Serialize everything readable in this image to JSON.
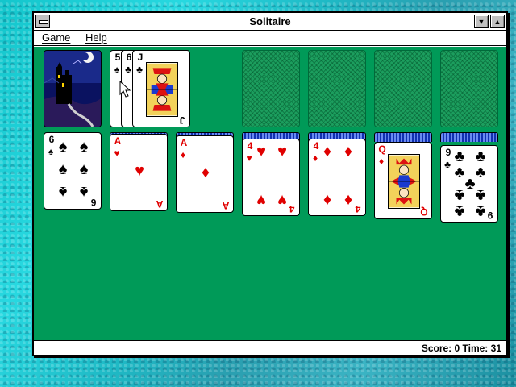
{
  "window": {
    "title": "Solitaire",
    "minimize_glyph": "▼",
    "maximize_glyph": "▲"
  },
  "menu": {
    "game": "Game",
    "help": "Help"
  },
  "status": {
    "text": "Score: 0 Time: 31"
  },
  "colors": {
    "felt": "#009a58",
    "red_suit": "#e00000",
    "card_back_blue": "#1030b0"
  },
  "stock": {
    "back_design": "castle"
  },
  "waste": {
    "cards": [
      {
        "rank": "5",
        "suit": "♠",
        "color": "black"
      },
      {
        "rank": "6",
        "suit": "♣",
        "color": "black"
      },
      {
        "rank": "J",
        "suit": "♣",
        "color": "black"
      }
    ]
  },
  "foundations": [
    "empty",
    "empty",
    "empty",
    "empty"
  ],
  "tableau": [
    {
      "rank": "6",
      "suit": "♠",
      "color": "black",
      "hidden_below": 0
    },
    {
      "rank": "A",
      "suit": "♥",
      "color": "red",
      "hidden_below": 1
    },
    {
      "rank": "A",
      "suit": "♦",
      "color": "red",
      "hidden_below": 1
    },
    {
      "rank": "4",
      "suit": "♥",
      "color": "red",
      "hidden_below": 3
    },
    {
      "rank": "4",
      "suit": "♦",
      "color": "red",
      "hidden_below": 3
    },
    {
      "rank": "Q",
      "suit": "♦",
      "color": "red",
      "hidden_below": 4
    },
    {
      "rank": "9",
      "suit": "♣",
      "color": "black",
      "hidden_below": 5
    }
  ]
}
